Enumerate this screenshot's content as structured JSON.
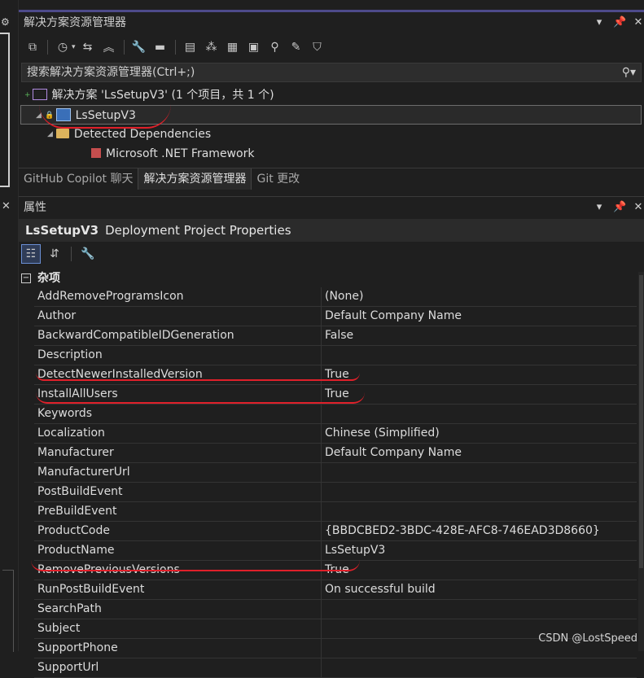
{
  "solution_explorer": {
    "title": "解决方案资源管理器",
    "search_placeholder": "搜索解决方案资源管理器(Ctrl+;)",
    "tree": {
      "solution": "解决方案 'LsSetupV3' (1 个项目，共 1 个)",
      "project": "LsSetupV3",
      "dependencies": "Detected Dependencies",
      "framework": "Microsoft .NET Framework"
    }
  },
  "tabs": [
    "GitHub Copilot 聊天",
    "解决方案资源管理器",
    "Git 更改"
  ],
  "properties": {
    "title": "属性",
    "object_name": "LsSetupV3",
    "object_type": "Deployment Project Properties",
    "section": "杂项",
    "rows": [
      {
        "name": "AddRemoveProgramsIcon",
        "value": "(None)"
      },
      {
        "name": "Author",
        "value": "Default Company Name"
      },
      {
        "name": "BackwardCompatibleIDGeneration",
        "value": "False"
      },
      {
        "name": "Description",
        "value": ""
      },
      {
        "name": "DetectNewerInstalledVersion",
        "value": "True"
      },
      {
        "name": "InstallAllUsers",
        "value": "True"
      },
      {
        "name": "Keywords",
        "value": ""
      },
      {
        "name": "Localization",
        "value": "Chinese (Simplified)"
      },
      {
        "name": "Manufacturer",
        "value": "Default Company Name"
      },
      {
        "name": "ManufacturerUrl",
        "value": ""
      },
      {
        "name": "PostBuildEvent",
        "value": ""
      },
      {
        "name": "PreBuildEvent",
        "value": ""
      },
      {
        "name": "ProductCode",
        "value": "{BBDCBED2-3BDC-428E-AFC8-746EAD3D8660}"
      },
      {
        "name": "ProductName",
        "value": "LsSetupV3"
      },
      {
        "name": "RemovePreviousVersions",
        "value": "True"
      },
      {
        "name": "RunPostBuildEvent",
        "value": "On successful build"
      },
      {
        "name": "SearchPath",
        "value": ""
      },
      {
        "name": "Subject",
        "value": ""
      },
      {
        "name": "SupportPhone",
        "value": ""
      },
      {
        "name": "SupportUrl",
        "value": ""
      }
    ]
  },
  "watermark": "CSDN @LostSpeed"
}
